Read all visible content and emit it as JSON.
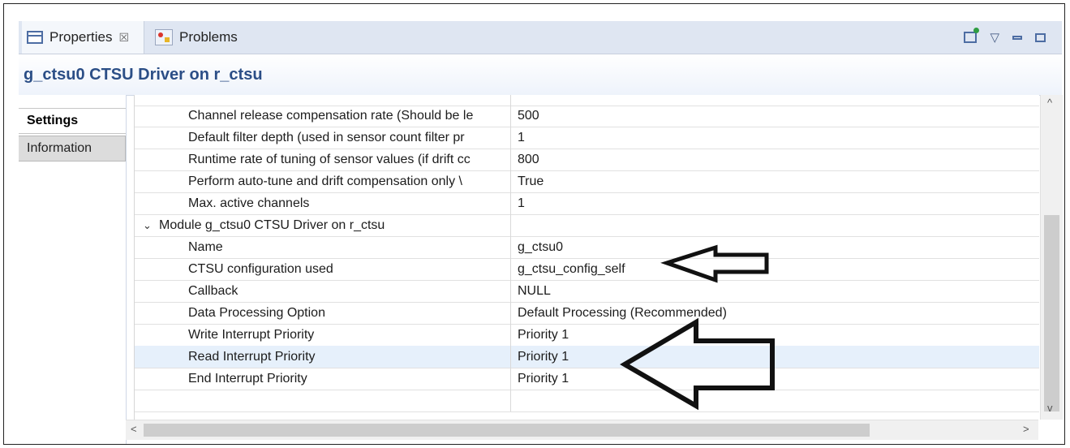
{
  "tabs": [
    {
      "label": "Properties",
      "close": "☒"
    },
    {
      "label": "Problems"
    }
  ],
  "title": "g_ctsu0 CTSU Driver on r_ctsu",
  "side_tabs": [
    "Settings",
    "Information"
  ],
  "rows": [
    {
      "prop": "Channel release compensation rate (Should be le",
      "value": "500"
    },
    {
      "prop": "Default filter depth (used in sensor count filter pr",
      "value": "1"
    },
    {
      "prop": "Runtime rate of tuning of sensor values (if drift cc",
      "value": "800"
    },
    {
      "prop": "Perform auto-tune and drift compensation only \\",
      "value": "True"
    },
    {
      "prop": "Max. active channels",
      "value": "1"
    },
    {
      "prop": "Module g_ctsu0 CTSU Driver on r_ctsu",
      "value": ""
    },
    {
      "prop": "Name",
      "value": "g_ctsu0"
    },
    {
      "prop": "CTSU configuration used",
      "value": "g_ctsu_config_self"
    },
    {
      "prop": "Callback",
      "value": "NULL"
    },
    {
      "prop": "Data Processing Option",
      "value": "Default Processing (Recommended)"
    },
    {
      "prop": "Write Interrupt Priority",
      "value": "Priority 1"
    },
    {
      "prop": "Read Interrupt Priority",
      "value": "Priority 1"
    },
    {
      "prop": "End Interrupt Priority",
      "value": "Priority 1"
    },
    {
      "prop": "",
      "value": ""
    }
  ],
  "icons": {
    "properties": "properties-icon",
    "problems": "problems-icon",
    "pin": "pin-icon",
    "view_menu": "chevron-down-icon",
    "minimize": "minimize-icon",
    "maximize": "maximize-icon",
    "expand": "chevron-down-icon"
  },
  "glyphs": {
    "expand": "⌄",
    "view_menu": "▽",
    "scroll_up": "^",
    "scroll_down": "v",
    "scroll_left": "<",
    "scroll_right": ">"
  },
  "colors": {
    "title": "#2b4e86",
    "selected_row": "#e6f0fb",
    "tabbar": "#dfe6f2"
  }
}
